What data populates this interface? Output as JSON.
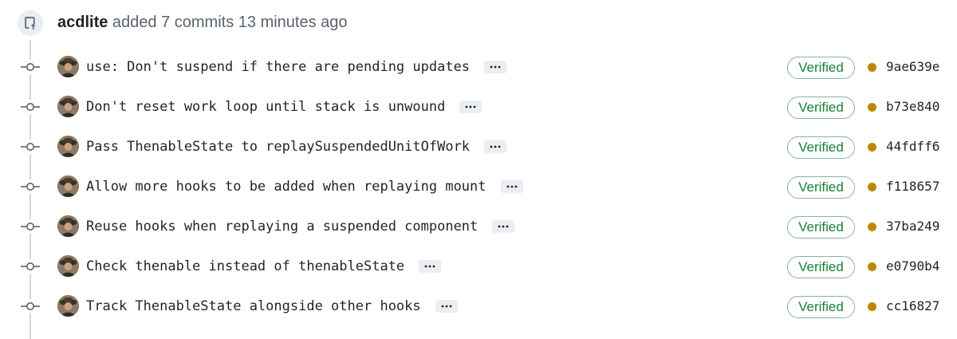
{
  "header": {
    "author": "acdlite",
    "summary": "added 7 commits 13 minutes ago",
    "icon": "push-icon"
  },
  "commits": [
    {
      "message": "use: Don't suspend if there are pending updates",
      "verified_label": "Verified",
      "sha": "9ae639e",
      "status": "pending"
    },
    {
      "message": "Don't reset work loop until stack is unwound",
      "verified_label": "Verified",
      "sha": "b73e840",
      "status": "pending"
    },
    {
      "message": "Pass ThenableState to replaySuspendedUnitOfWork",
      "verified_label": "Verified",
      "sha": "44fdff6",
      "status": "pending"
    },
    {
      "message": "Allow more hooks to be added when replaying mount",
      "verified_label": "Verified",
      "sha": "f118657",
      "status": "pending"
    },
    {
      "message": "Reuse hooks when replaying a suspended component",
      "verified_label": "Verified",
      "sha": "37ba249",
      "status": "pending"
    },
    {
      "message": "Check thenable instead of thenableState",
      "verified_label": "Verified",
      "sha": "e0790b4",
      "status": "pending"
    },
    {
      "message": "Track ThenableState alongside other hooks",
      "verified_label": "Verified",
      "sha": "cc16827",
      "status": "pending"
    }
  ],
  "colors": {
    "verified": "#1a7f37",
    "pending_dot": "#bf8700",
    "timeline": "#d0d7de"
  }
}
